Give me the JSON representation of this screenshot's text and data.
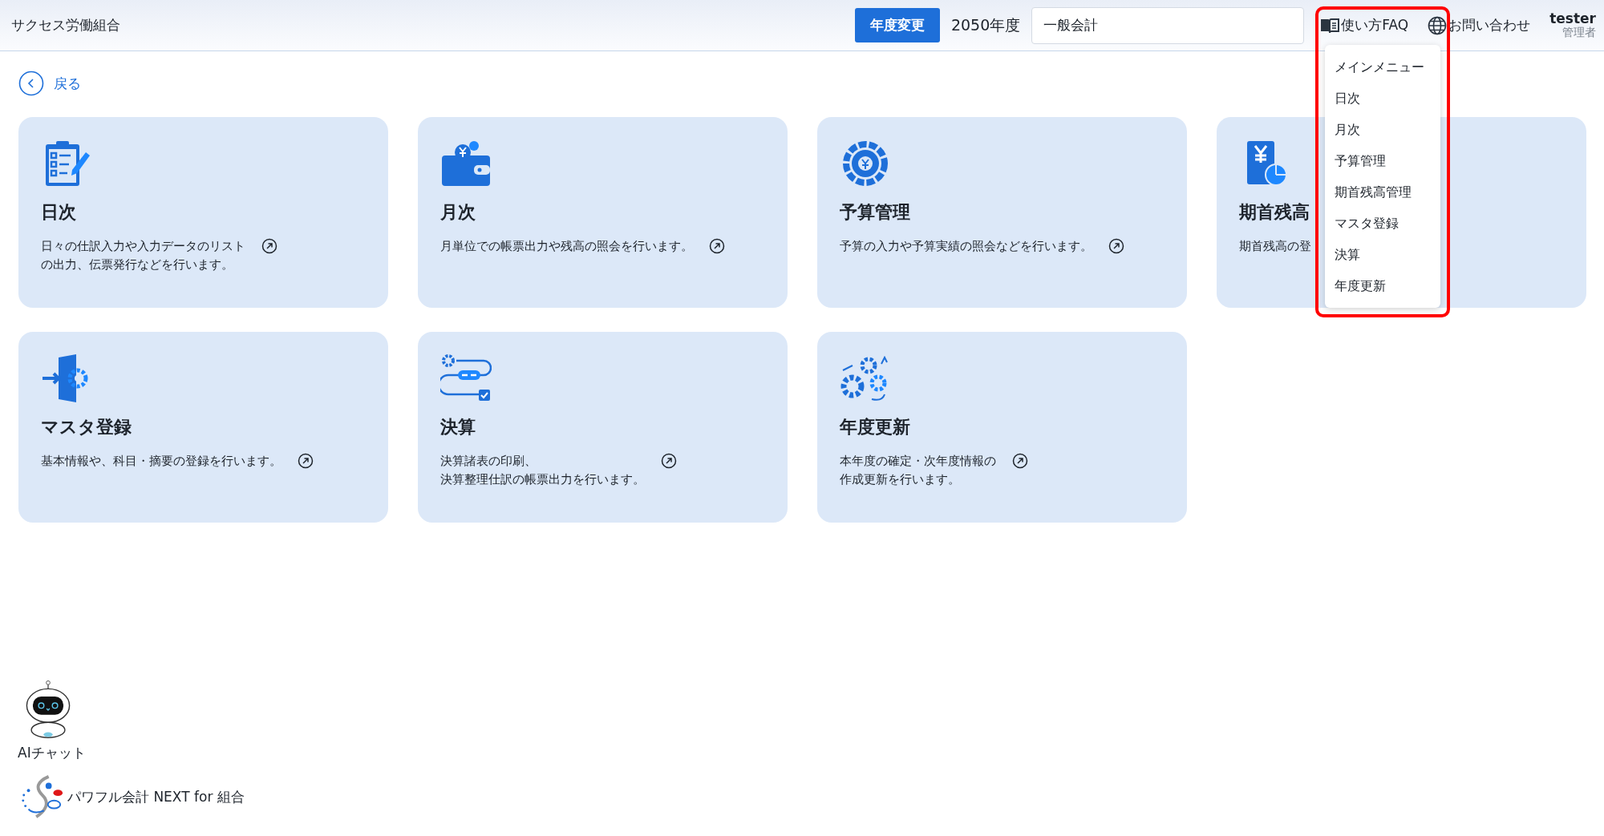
{
  "header": {
    "org_name": "サクセス労働組合",
    "year_button": "年度変更",
    "fiscal_year": "2050年度",
    "account_select": {
      "value": "一般会計"
    },
    "faq_link": "使い方FAQ",
    "contact_link": "お問い合わせ",
    "user": {
      "name": "tester",
      "role": "管理者"
    }
  },
  "menu_dropdown": {
    "expanded": true,
    "highlighted": true,
    "items": [
      "メインメニュー",
      "日次",
      "月次",
      "予算管理",
      "期首残高管理",
      "マスタ登録",
      "決算",
      "年度更新"
    ]
  },
  "back_link": "戻る",
  "cards": [
    {
      "kind": "clipboard",
      "title": "日次",
      "lines": [
        "日々の仕訳入力や入力データのリスト",
        "の出力、伝票発行などを行います。"
      ],
      "arrow": true
    },
    {
      "kind": "wallet",
      "title": "月次",
      "lines": [
        "月単位での帳票出力や残高の照会を行います。"
      ],
      "arrow": true
    },
    {
      "kind": "budget",
      "title": "予算管理",
      "lines": [
        "予算の入力や予算実績の照会などを行います。"
      ],
      "arrow": true
    },
    {
      "kind": "ledger",
      "title": "期首残高",
      "lines": [
        "期首残高の登"
      ],
      "arrow": false
    },
    {
      "kind": "master",
      "title": "マスタ登録",
      "lines": [
        "基本情報や、科目・摘要の登録を行います。"
      ],
      "arrow": true
    },
    {
      "kind": "settle",
      "title": "決算",
      "lines": [
        "決算諸表の印刷、",
        "決算整理仕訳の帳票出力を行います。"
      ],
      "arrow": true
    },
    {
      "kind": "renew",
      "title": "年度更新",
      "lines": [
        "本年度の確定・次年度情報の",
        "作成更新を行います。"
      ],
      "arrow": true
    }
  ],
  "footer": {
    "ai_chat": "AIチャット",
    "product_name": "パワフル会計 NEXT for 組合"
  }
}
